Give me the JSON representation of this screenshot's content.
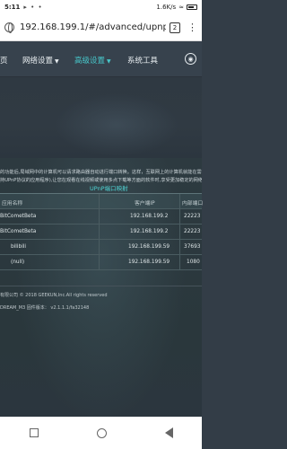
{
  "status_bar": {
    "time": "5:11",
    "dots": "▸ • •",
    "network_speed": "1.6K/s",
    "battery": ""
  },
  "browser": {
    "url": "192.168.199.1/#/advanced/upnp",
    "tab_count": "2"
  },
  "nav": {
    "items": [
      {
        "label": "页",
        "active": false
      },
      {
        "label": "网络设置",
        "active": false,
        "caret": "▼"
      },
      {
        "label": "高级设置",
        "active": true,
        "caret": "▼"
      },
      {
        "label": "系统工具",
        "active": false
      }
    ],
    "weibo_icon": "weibo-icon"
  },
  "description": {
    "line1": "的功能后,局域网中的计算机可以请求路由器自动进行端口转换。这样，互联网上的计算机就能在需",
    "line2": "持UPnP协议的应用程序),让您在观看在线视频或使用多点下载等方面的软件时,享受更加稳定的网络"
  },
  "upnp": {
    "title": "UPnP端口映射",
    "columns": [
      "应用名称",
      "客户端IP",
      "内部端口"
    ],
    "rows": [
      {
        "name": "BitCometBeta",
        "ip": "192.168.199.2",
        "port": "22223"
      },
      {
        "name": "BitCometBeta",
        "ip": "192.168.199.2",
        "port": "22223"
      },
      {
        "name": "bilibili",
        "ip": "192.168.199.59",
        "port": "37693"
      },
      {
        "name": "(null)",
        "ip": "192.168.199.59",
        "port": "1080"
      }
    ]
  },
  "footer": {
    "copyright": "有限公司 © 2018 GEEKUN,Inc.All rights reserved",
    "firmware": "DREAM_M3   固件版本： v2.1.1.1/fa32148"
  },
  "colors": {
    "accent": "#47c6c9",
    "background": "#333d47"
  }
}
